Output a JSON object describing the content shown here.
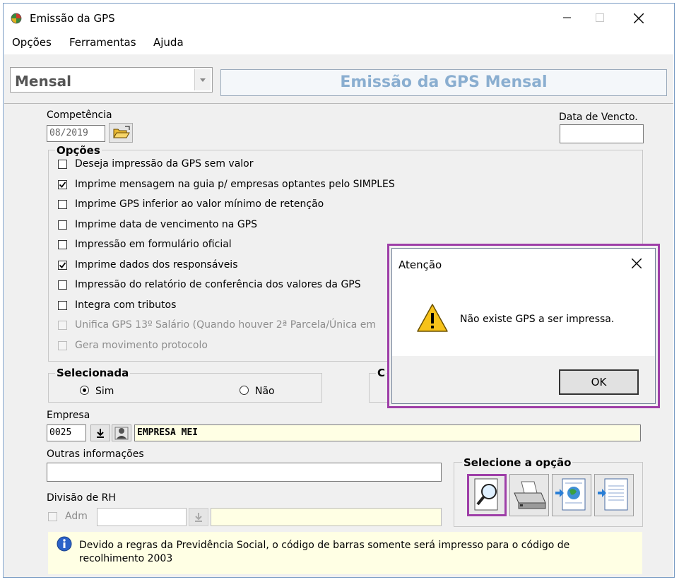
{
  "window": {
    "title": "Emissão da GPS"
  },
  "menu": [
    "Opções",
    "Ferramentas",
    "Ajuda"
  ],
  "mode_select": {
    "value": "Mensal"
  },
  "banner": "Emissão da GPS Mensal",
  "competencia": {
    "label": "Competência",
    "value": "08/2019"
  },
  "data_vencto": {
    "label": "Data de Vencto.",
    "value": ""
  },
  "opcoes": {
    "title": "Opções",
    "items": [
      {
        "label": "Deseja impressão da GPS sem valor",
        "checked": false,
        "disabled": false
      },
      {
        "label": "Imprime mensagem na guia p/ empresas optantes pelo SIMPLES",
        "checked": true,
        "disabled": false
      },
      {
        "label": "Imprime GPS inferior ao valor mínimo de retenção",
        "checked": false,
        "disabled": false
      },
      {
        "label": "Imprime data de vencimento na GPS",
        "checked": false,
        "disabled": false
      },
      {
        "label": "Impressão em formulário oficial",
        "checked": false,
        "disabled": false
      },
      {
        "label": "Imprime dados dos responsáveis",
        "checked": true,
        "disabled": false
      },
      {
        "label": "Impressão do relatório de conferência dos valores da GPS",
        "checked": false,
        "disabled": false
      },
      {
        "label": "Integra com tributos",
        "checked": false,
        "disabled": false
      },
      {
        "label": "Unifica GPS 13º Salário (Quando houver 2ª Parcela/Única em",
        "checked": false,
        "disabled": true
      },
      {
        "label": "Gera movimento protocolo",
        "checked": false,
        "disabled": true
      }
    ]
  },
  "selecionada": {
    "title": "Selecionada",
    "sim": "Sim",
    "nao": "Não",
    "selected": "Sim"
  },
  "hidden_group_title": "C",
  "empresa": {
    "label": "Empresa",
    "code": "0025",
    "name": "EMPRESA MEI"
  },
  "outras": {
    "label": "Outras informações",
    "value": ""
  },
  "divisao": {
    "label": "Divisão de RH",
    "adm_label": "Adm",
    "value": ""
  },
  "selecione": {
    "title": "Selecione a opção"
  },
  "info_text": "Devido a regras da Previdência Social, o código de barras somente será impresso para o código de recolhimento 2003",
  "dialog": {
    "title": "Atenção",
    "message": "Não existe GPS a ser impressa.",
    "ok_label": "OK"
  },
  "colors": {
    "dialog_highlight": "#9e3fa8",
    "banner_text": "#8aaed0",
    "info_bg": "#ffffe4",
    "empresa_bg": "#ffffe4"
  }
}
